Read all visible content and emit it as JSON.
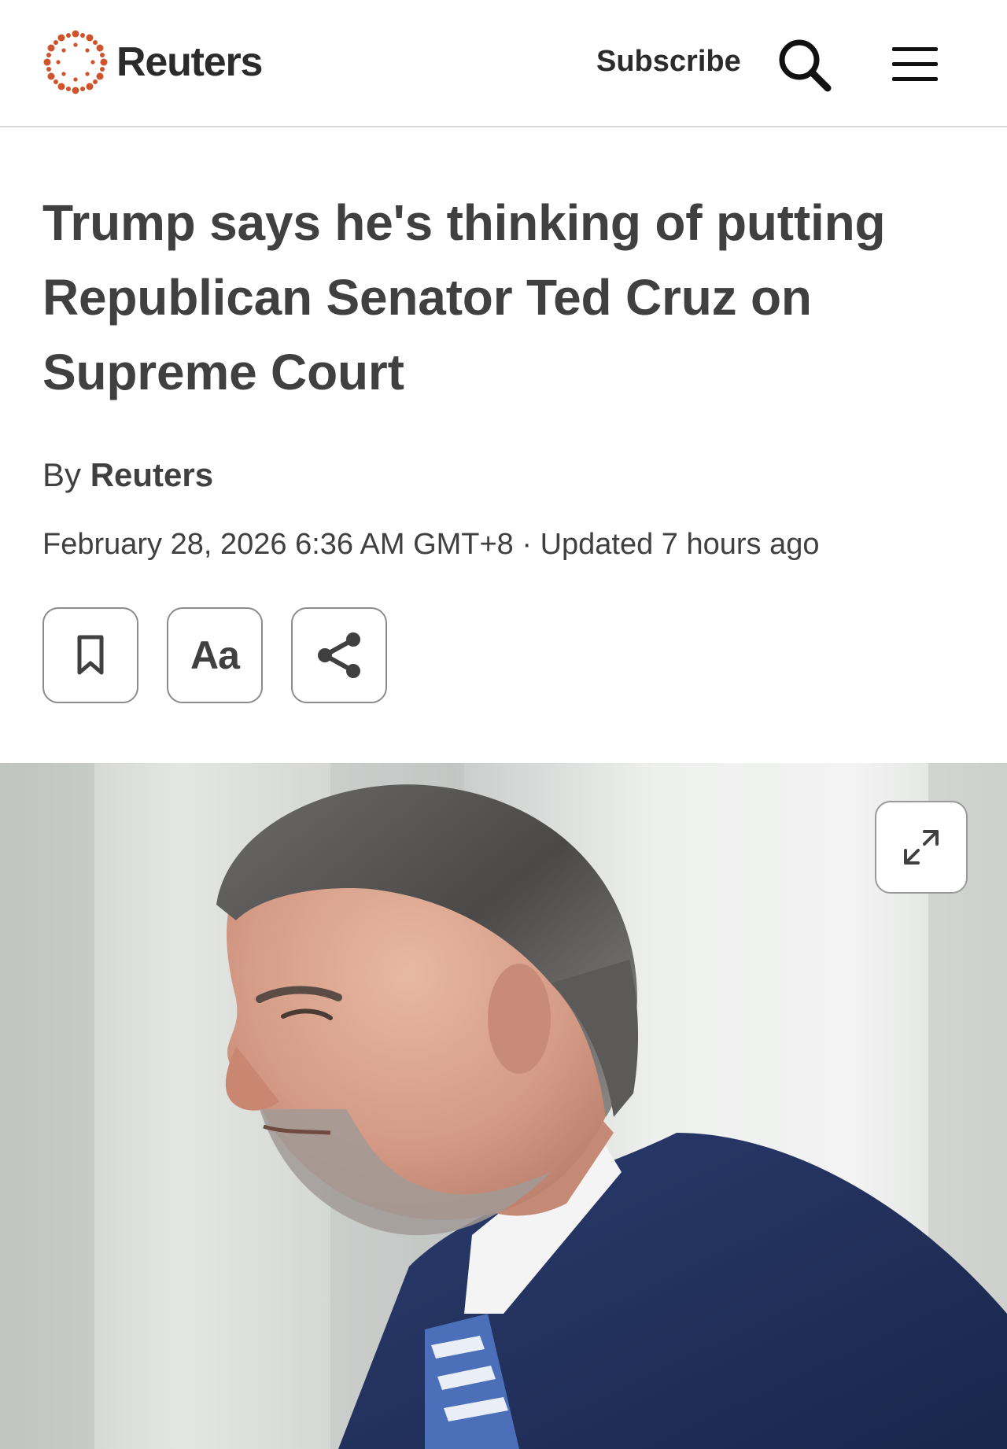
{
  "header": {
    "logo_text": "Reuters",
    "subscribe_label": "Subscribe",
    "search_icon": "search-icon",
    "menu_icon": "hamburger-menu-icon"
  },
  "article": {
    "headline": "Trump says he's thinking of putting Republican Senator Ted Cruz on Supreme Court",
    "byline_prefix": "By",
    "byline_author": "Reuters",
    "dateline": "February 28, 2026 6:36 AM GMT+8 · Updated 7 hours ago"
  },
  "tools": {
    "bookmark_icon": "bookmark-icon",
    "text_size_label": "Aa",
    "share_icon": "share-icon"
  },
  "photo": {
    "expand_icon": "expand-icon"
  },
  "colors": {
    "brand_orange": "#d0542b",
    "text": "#404040",
    "border": "#8c8c8c"
  }
}
